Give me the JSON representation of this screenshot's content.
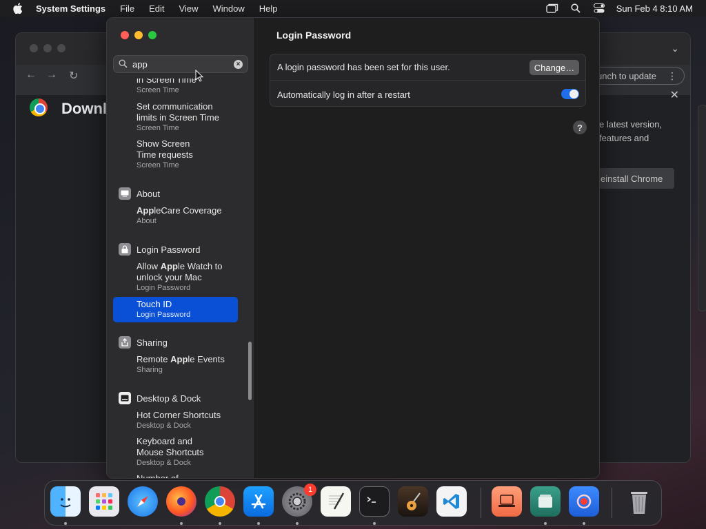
{
  "menubar": {
    "app_name": "System Settings",
    "items": [
      "File",
      "Edit",
      "View",
      "Window",
      "Help"
    ],
    "clock": "Sun Feb 4  8:10 AM"
  },
  "background_window": {
    "page_title_partial": "Downl",
    "update_button_partial": "unch to update",
    "update_text_line1": "e latest version,",
    "update_text_line2": "features and",
    "reinstall_label": "einstall Chrome"
  },
  "settings": {
    "search": {
      "value": "app"
    },
    "sidebar": {
      "results": [
        {
          "title": "in Screen Time",
          "sub": "Screen Time"
        },
        {
          "title": "Set communication limits in Screen Time",
          "title_l1": "Set communication",
          "title_l2": "limits in Screen Time",
          "sub": "Screen Time"
        },
        {
          "title_l1": "Show Screen",
          "title_l2": "Time requests",
          "sub": "Screen Time"
        },
        {
          "title_pre": "",
          "title_hl": "App",
          "title_post": "leCare Coverage",
          "sub": "About"
        },
        {
          "l1_pre": "Allow ",
          "l1_hl": "App",
          "l1_post": "le Watch to",
          "title_l2": "unlock your Mac",
          "sub": "Login Password"
        },
        {
          "title": "Touch ID",
          "sub": "Login Password",
          "selected": true
        },
        {
          "title_pre": "Remote ",
          "title_hl": "App",
          "title_post": "le Events",
          "sub": "Sharing"
        },
        {
          "title": "Hot Corner Shortcuts",
          "sub": "Desktop & Dock"
        },
        {
          "title_l1": "Keyboard and",
          "title_l2": "Mouse Shortcuts",
          "sub": "Desktop & Dock"
        },
        {
          "title": "Number of"
        }
      ],
      "sections": [
        "About",
        "Login Password",
        "Sharing",
        "Desktop & Dock"
      ]
    },
    "content": {
      "heading": "Login Password",
      "row1_label": "A login password has been set for this user.",
      "change_button": "Change…",
      "row2_label": "Automatically log in after a restart",
      "auto_login_enabled": true,
      "help_label": "?"
    }
  },
  "dock": {
    "apps": [
      "Finder",
      "Launchpad",
      "Safari",
      "Firefox",
      "Chrome",
      "App Store",
      "System Settings",
      "TextEdit",
      "Terminal",
      "GarageBand",
      "Visual Studio Code",
      "Remote Desktop",
      "Files",
      "Screen Recorder",
      "Trash"
    ],
    "settings_badge": "1"
  },
  "colors": {
    "selection": "#0a50d6",
    "toggle_on": "#1f6feb",
    "traffic_red": "#ff5f57",
    "traffic_yellow": "#febc2e",
    "traffic_green": "#28c840"
  }
}
